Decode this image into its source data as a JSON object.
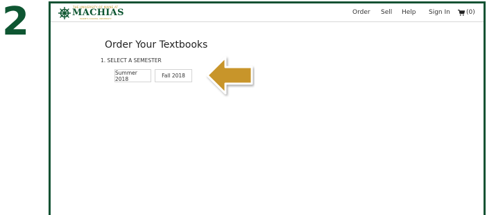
{
  "step_number": "2",
  "logo": {
    "small_text": "THE UNIVERSITY OF MAINE AT",
    "name": "MACHIAS",
    "tagline": "MAINE'S COASTAL UNIVERSITY"
  },
  "nav": {
    "order": "Order",
    "sell": "Sell",
    "help": "Help",
    "sign_in": "Sign In",
    "cart": "(0)"
  },
  "page": {
    "title": "Order Your Textbooks",
    "step_label": "1. SELECT A SEMESTER",
    "semesters": [
      "Summer 2018",
      "Fall 2018"
    ]
  },
  "colors": {
    "brand_green": "#0e5632",
    "brand_gold": "#c29a2a",
    "arrow_gold": "#c8952c"
  },
  "icons": {
    "cart": "cart-icon",
    "logo": "ship-wheel-icon",
    "arrow": "left-arrow-icon"
  }
}
